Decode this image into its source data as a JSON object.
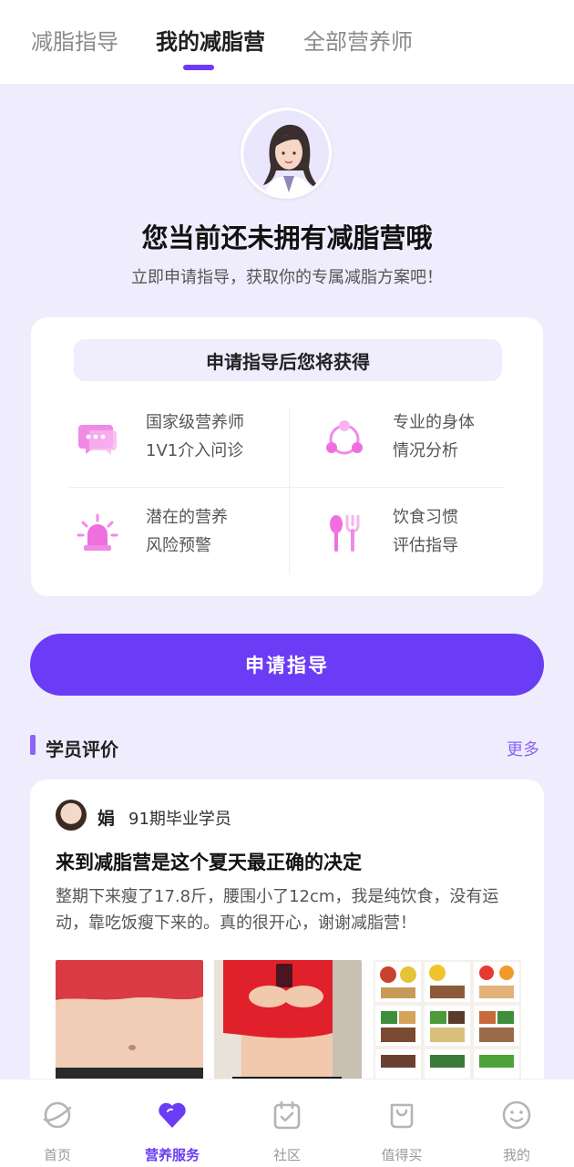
{
  "top_tabs": [
    {
      "label": "减脂指导",
      "active": false
    },
    {
      "label": "我的减脂营",
      "active": true
    },
    {
      "label": "全部营养师",
      "active": false
    }
  ],
  "hero": {
    "title": "您当前还未拥有减脂营哦",
    "subtitle": "立即申请指导，获取你的专属减脂方案吧！"
  },
  "benefits": {
    "header": "申请指导后您将获得",
    "items": [
      {
        "line1": "国家级营养师",
        "line2": "1V1介入问诊",
        "icon": "chat-bubble-icon"
      },
      {
        "line1": "专业的身体",
        "line2": "情况分析",
        "icon": "share-nodes-icon"
      },
      {
        "line1": "潜在的营养",
        "line2": "风险预警",
        "icon": "alarm-light-icon"
      },
      {
        "line1": "饮食习惯",
        "line2": "评估指导",
        "icon": "spoon-fork-icon"
      }
    ]
  },
  "apply_button": "申请指导",
  "reviews_section": {
    "title": "学员评价",
    "more": "更多"
  },
  "review": {
    "name": "娟",
    "info": "91期毕业学员",
    "title": "来到减脂营是这个夏天最正确的决定",
    "text": "整期下来瘦了17.8斤，腰围小了12cm，我是纯饮食，没有运动，靠吃饭瘦下来的。真的很开心，谢谢减脂营！"
  },
  "bottom_nav": [
    {
      "label": "首页",
      "icon": "planet-icon",
      "active": false
    },
    {
      "label": "营养服务",
      "icon": "heart-icon",
      "active": true
    },
    {
      "label": "社区",
      "icon": "calendar-check-icon",
      "active": false
    },
    {
      "label": "值得买",
      "icon": "shopping-bag-icon",
      "active": false
    },
    {
      "label": "我的",
      "icon": "smiley-icon",
      "active": false
    }
  ],
  "colors": {
    "accent": "#6b3cf5",
    "icon_pink": "#ef6fe0",
    "background": "#efedfd"
  }
}
